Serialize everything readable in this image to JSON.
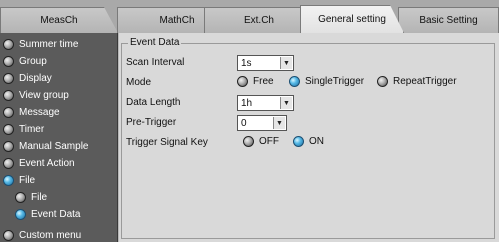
{
  "tabs": [
    {
      "label": "MeasCh"
    },
    {
      "label": "MathCh"
    },
    {
      "label": "Ext.Ch"
    },
    {
      "label": "General setting"
    },
    {
      "label": "Basic Setting"
    }
  ],
  "sidebar": {
    "items": [
      {
        "label": "Summer time",
        "selected": false
      },
      {
        "label": "Group",
        "selected": false
      },
      {
        "label": "Display",
        "selected": false
      },
      {
        "label": "View group",
        "selected": false
      },
      {
        "label": "Message",
        "selected": false
      },
      {
        "label": "Timer",
        "selected": false
      },
      {
        "label": "Manual Sample",
        "selected": false
      },
      {
        "label": "Event Action",
        "selected": false
      },
      {
        "label": "File",
        "selected": true
      },
      {
        "label": "File",
        "selected": false
      },
      {
        "label": "Event Data",
        "selected": true
      },
      {
        "label": "Custom menu",
        "selected": false
      }
    ]
  },
  "event_data": {
    "group_title": "Event Data",
    "scan_interval": {
      "label": "Scan Interval",
      "value": "1s"
    },
    "mode": {
      "label": "Mode",
      "options": [
        "Free",
        "SingleTrigger",
        "RepeatTrigger"
      ],
      "selected": "SingleTrigger"
    },
    "data_length": {
      "label": "Data Length",
      "value": "1h"
    },
    "pre_trigger": {
      "label": "Pre-Trigger",
      "value": "0"
    },
    "trigger_signal_key": {
      "label": "Trigger Signal Key",
      "options": [
        "OFF",
        "ON"
      ],
      "selected": "ON"
    }
  },
  "colors": {
    "sidebar_bg": "#5b5b5b",
    "panel_bg": "#d9d9d9",
    "accent_radio": "#54b8e6"
  }
}
